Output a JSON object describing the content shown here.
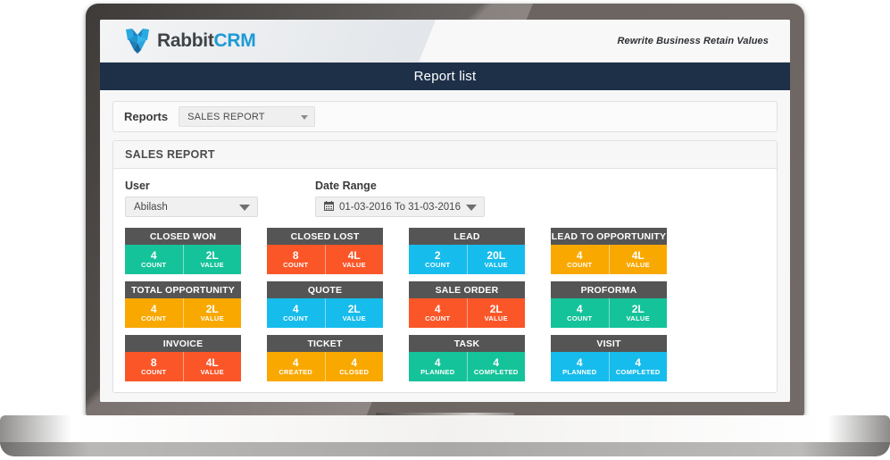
{
  "brand": {
    "name_part1": "Rabbit",
    "name_part2": "CRM",
    "tagline": "Rewrite Business Retain Values"
  },
  "page": {
    "title": "Report list"
  },
  "reports_bar": {
    "label": "Reports",
    "selected": "SALES REPORT"
  },
  "panel": {
    "title": "SALES REPORT"
  },
  "filters": {
    "user": {
      "label": "User",
      "value": "Abilash"
    },
    "date_range": {
      "label": "Date Range",
      "value": "01-03-2016 To 31-03-2016"
    }
  },
  "colors": {
    "teal": "#15c39a",
    "orange_red": "#fb5628",
    "blue": "#16bcec",
    "amber": "#f9a800",
    "card_header": "#555555",
    "navy": "#1d3048",
    "brand_blue": "#1c9ad6"
  },
  "cards": [
    [
      {
        "title": "CLOSED WON",
        "color": "teal",
        "cells": [
          {
            "value": "4",
            "label": "COUNT"
          },
          {
            "value": "2L",
            "label": "VALUE"
          }
        ]
      },
      {
        "title": "CLOSED LOST",
        "color": "orange_red",
        "cells": [
          {
            "value": "8",
            "label": "COUNT"
          },
          {
            "value": "4L",
            "label": "VALUE"
          }
        ]
      },
      {
        "title": "LEAD",
        "color": "blue",
        "cells": [
          {
            "value": "2",
            "label": "COUNT"
          },
          {
            "value": "20L",
            "label": "VALUE"
          }
        ]
      },
      {
        "title": "LEAD TO OPPORTUNITY",
        "color": "amber",
        "cells": [
          {
            "value": "4",
            "label": "COUNT"
          },
          {
            "value": "4L",
            "label": "VALUE"
          }
        ]
      }
    ],
    [
      {
        "title": "TOTAL OPPORTUNITY",
        "color": "amber",
        "cells": [
          {
            "value": "4",
            "label": "COUNT"
          },
          {
            "value": "2L",
            "label": "VALUE"
          }
        ]
      },
      {
        "title": "QUOTE",
        "color": "blue",
        "cells": [
          {
            "value": "4",
            "label": "COUNT"
          },
          {
            "value": "2L",
            "label": "VALUE"
          }
        ]
      },
      {
        "title": "SALE ORDER",
        "color": "orange_red",
        "cells": [
          {
            "value": "4",
            "label": "COUNT"
          },
          {
            "value": "2L",
            "label": "VALUE"
          }
        ]
      },
      {
        "title": "PROFORMA",
        "color": "teal",
        "cells": [
          {
            "value": "4",
            "label": "COUNT"
          },
          {
            "value": "2L",
            "label": "VALUE"
          }
        ]
      }
    ],
    [
      {
        "title": "INVOICE",
        "color": "orange_red",
        "cells": [
          {
            "value": "8",
            "label": "COUNT"
          },
          {
            "value": "4L",
            "label": "VALUE"
          }
        ]
      },
      {
        "title": "TICKET",
        "color": "amber",
        "cells": [
          {
            "value": "4",
            "label": "CREATED"
          },
          {
            "value": "4",
            "label": "CLOSED"
          }
        ]
      },
      {
        "title": "TASK",
        "color": "teal",
        "cells": [
          {
            "value": "4",
            "label": "PLANNED"
          },
          {
            "value": "4",
            "label": "COMPLETED"
          }
        ]
      },
      {
        "title": "VISIT",
        "color": "blue",
        "cells": [
          {
            "value": "4",
            "label": "PLANNED"
          },
          {
            "value": "4",
            "label": "COMPLETED"
          }
        ]
      }
    ]
  ]
}
